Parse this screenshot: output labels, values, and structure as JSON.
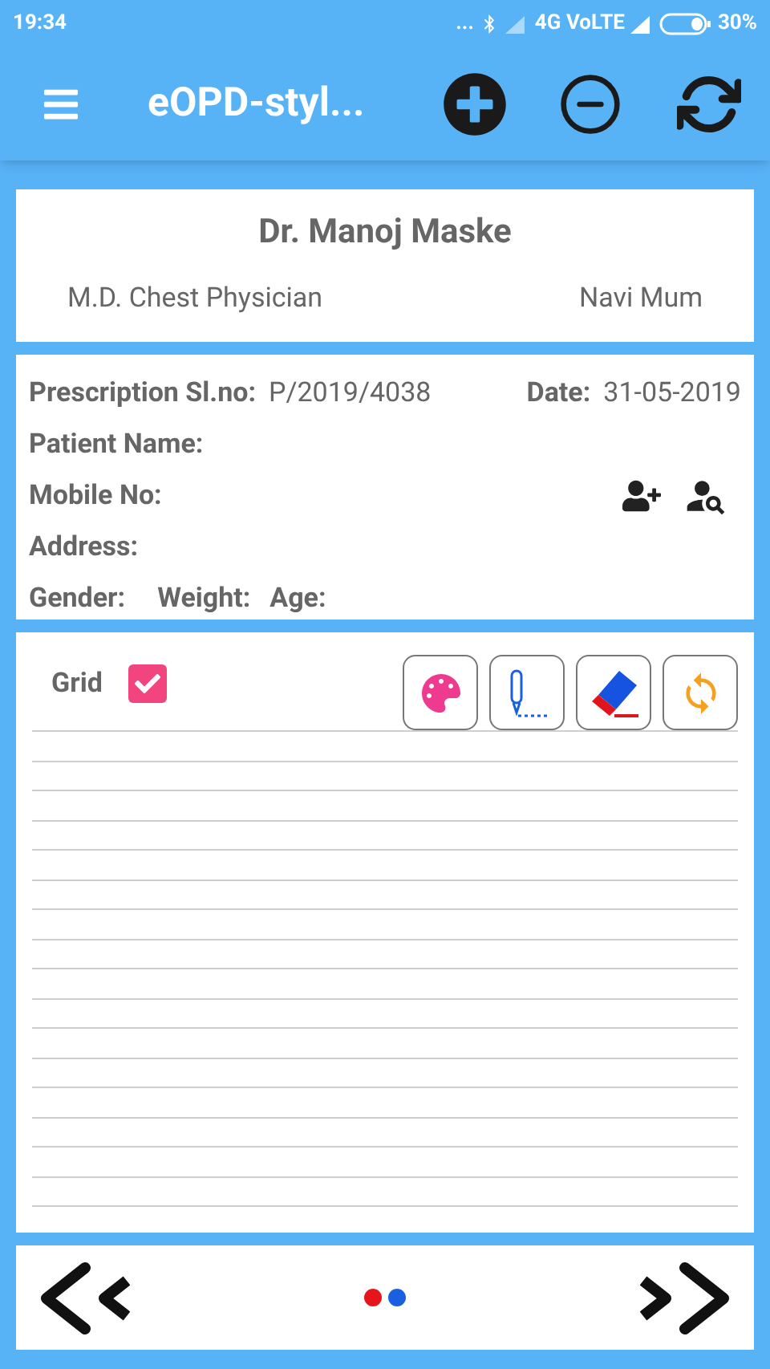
{
  "status_bar": {
    "time": "19:34",
    "dots": "...",
    "network": "4G VoLTE",
    "battery": "30%"
  },
  "app_bar": {
    "title": "eOPD-styl..."
  },
  "doctor": {
    "name": "Dr. Manoj Maske",
    "qualification": "M.D. Chest Physician",
    "location": "Navi Mum"
  },
  "patient": {
    "serial_label": "Prescription Sl.no:",
    "serial": "P/2019/4038",
    "date_label": "Date:",
    "date": "31-05-2019",
    "name_label": "Patient Name:",
    "mobile_label": "Mobile No:",
    "address_label": "Address:",
    "gender_label": "Gender:",
    "weight_label": "Weight:",
    "age_label": "Age:"
  },
  "canvas": {
    "grid_label": "Grid",
    "grid": {
      "checked": true
    }
  },
  "page_dots": [
    {
      "color": "#e8141c"
    },
    {
      "color": "#1a5fe0"
    }
  ]
}
